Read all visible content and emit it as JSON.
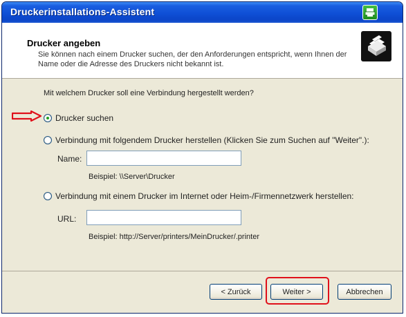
{
  "window": {
    "title": "Druckerinstallations-Assistent"
  },
  "header": {
    "title": "Drucker angeben",
    "description": "Sie können nach einem Drucker suchen, der den Anforderungen entspricht, wenn Ihnen der Name oder die Adresse des Druckers nicht bekannt ist.",
    "icon": "printer-icon"
  },
  "content": {
    "question": "Mit welchem Drucker soll eine Verbindung hergestellt werden?",
    "options": [
      {
        "label": "Drucker suchen",
        "checked": true
      },
      {
        "label": "Verbindung mit folgendem Drucker herstellen (Klicken Sie zum Suchen auf \"Weiter\".):",
        "checked": false
      },
      {
        "label": "Verbindung mit einem Drucker im Internet oder Heim-/Firmennetzwerk herstellen:",
        "checked": false
      }
    ],
    "name_label": "Name:",
    "name_value": "",
    "name_example": "Beispiel: \\\\Server\\Drucker",
    "url_label": "URL:",
    "url_value": "",
    "url_example": "Beispiel: http://Server/printers/MeinDrucker/.printer"
  },
  "buttons": {
    "back": "< Zurück",
    "next": "Weiter >",
    "cancel": "Abbrechen"
  },
  "colors": {
    "annotation": "#e0101a",
    "titlebar": "#0f4fd6"
  }
}
